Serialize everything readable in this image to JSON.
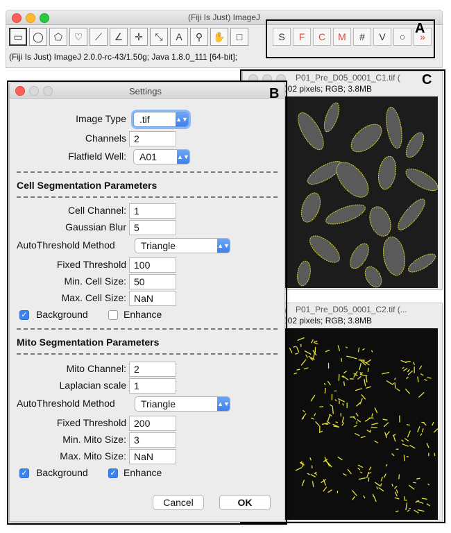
{
  "main_window": {
    "title": "(Fiji Is Just) ImageJ",
    "status": "(Fiji Is Just) ImageJ 2.0.0-rc-43/1.50g; Java 1.8.0_111 [64-bit];",
    "tools": [
      "rectangle-tool",
      "oval-tool",
      "polygon-tool",
      "freehand-tool",
      "line-tool",
      "angle-tool",
      "point-tool",
      "wand-tool",
      "text-tool",
      "magnifier-tool",
      "hand-tool",
      "color-picker-tool"
    ],
    "tool_glyphs": [
      "▭",
      "◯",
      "⬠",
      "♡",
      "⟋",
      "∠",
      "✛",
      "⤡",
      "A",
      "⚲",
      "✋",
      "□"
    ],
    "plugin_buttons": [
      "S",
      "F",
      "C",
      "M",
      "#",
      "V",
      "○",
      "»"
    ]
  },
  "callouts": {
    "a": "A",
    "b": "B",
    "c": "C"
  },
  "image_windows": [
    {
      "title": "P01_Pre_D05_0001_C1.tif (",
      "info": "002 pixels; RGB; 3.8MB"
    },
    {
      "title": "P01_Pre_D05_0001_C2.tif (...",
      "info": "002 pixels; RGB; 3.8MB"
    }
  ],
  "settings": {
    "title": "Settings",
    "image_type_label": "Image Type",
    "image_type_value": ".tif",
    "channels_label": "Channels",
    "channels_value": "2",
    "flatfield_label": "Flatfield Well:",
    "flatfield_value": "A01",
    "cell_section": "Cell Segmentation Parameters",
    "cell": {
      "channel_label": "Cell Channel:",
      "channel_value": "1",
      "blur_label": "Gaussian Blur",
      "blur_value": "5",
      "method_label": "AutoThreshold Method",
      "method_value": "Triangle",
      "fixed_label": "Fixed Threshold",
      "fixed_value": "100",
      "min_label": "Min. Cell Size:",
      "min_value": "50",
      "max_label": "Max. Cell Size:",
      "max_value": "NaN",
      "background_label": "Background",
      "background_checked": true,
      "enhance_label": "Enhance",
      "enhance_checked": false
    },
    "mito_section": "Mito Segmentation Parameters",
    "mito": {
      "channel_label": "Mito Channel:",
      "channel_value": "2",
      "laplacian_label": "Laplacian scale",
      "laplacian_value": "1",
      "method_label": "AutoThreshold Method",
      "method_value": "Triangle",
      "fixed_label": "Fixed Threshold",
      "fixed_value": "200",
      "min_label": "Min. Mito Size:",
      "min_value": "3",
      "max_label": "Max. Mito Size:",
      "max_value": "NaN",
      "background_label": "Background",
      "background_checked": true,
      "enhance_label": "Enhance",
      "enhance_checked": true
    },
    "cancel_label": "Cancel",
    "ok_label": "OK"
  },
  "colors": {
    "outline": "#d8d42a",
    "mito": "#e6e23a",
    "check_blue": "#3a84f0"
  }
}
